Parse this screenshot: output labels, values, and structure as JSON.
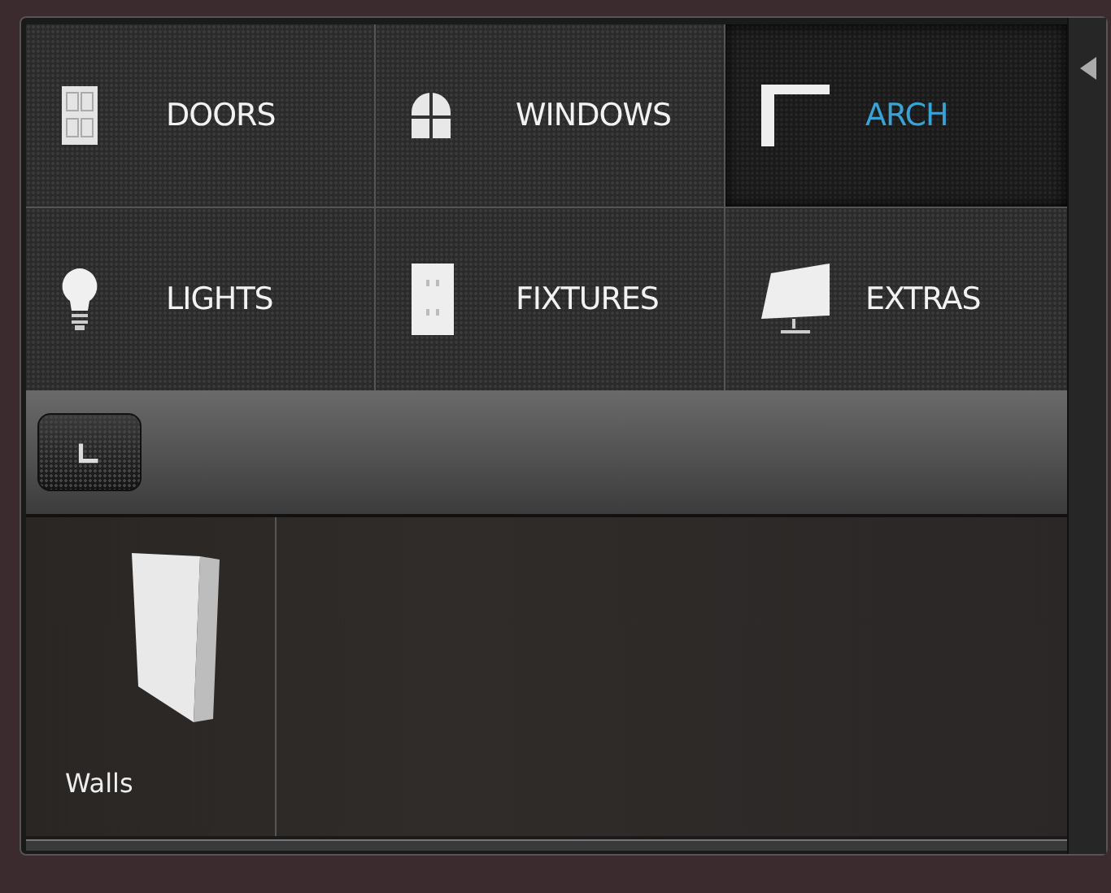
{
  "categories": [
    {
      "label": "DOORS",
      "kind": "door",
      "selected": false
    },
    {
      "label": "WINDOWS",
      "kind": "window",
      "selected": false
    },
    {
      "label": "ARCH",
      "kind": "arch",
      "selected": true
    },
    {
      "label": "LIGHTS",
      "kind": "light",
      "selected": false
    },
    {
      "label": "FIXTURES",
      "kind": "fixture",
      "selected": false
    },
    {
      "label": "EXTRAS",
      "kind": "extra",
      "selected": false
    }
  ],
  "items": [
    {
      "label": "Walls",
      "kind": "wall"
    }
  ]
}
